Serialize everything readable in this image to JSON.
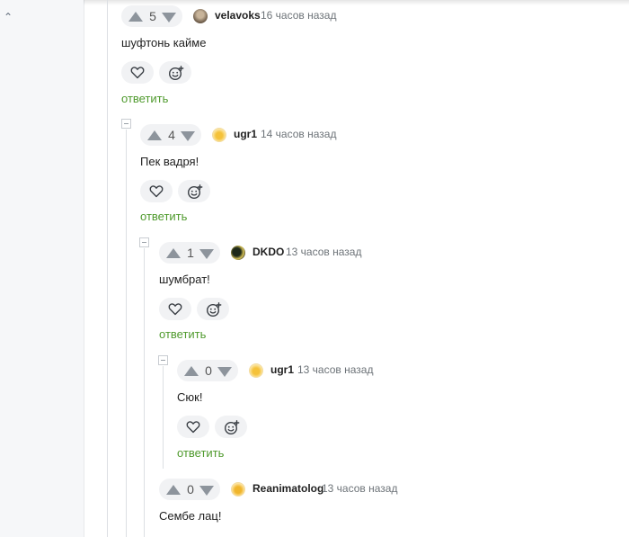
{
  "sidebar": {
    "collapse_icon": "chevron-up-icon",
    "collapse_glyph": "⌃"
  },
  "colors": {
    "reply_link": "#4f9a2d",
    "pill_bg": "#f1f2f4",
    "arrow": "#8d949c"
  },
  "comments": [
    {
      "rating": "5",
      "avatar_icon": "user-avatar",
      "username": "velavoks",
      "time": "16 часов назад",
      "text": "шуфтонь кайме",
      "reply": "ответить"
    },
    {
      "rating": "4",
      "avatar_icon": "user-avatar",
      "username": "ugr1",
      "time": "14 часов назад",
      "text": "Пек вадря!",
      "reply": "ответить"
    },
    {
      "rating": "1",
      "avatar_icon": "user-avatar",
      "username": "DKDO",
      "time": "13 часов назад",
      "text": "шумбрат!",
      "reply": "ответить"
    },
    {
      "rating": "0",
      "avatar_icon": "user-avatar",
      "username": "ugr1",
      "time": "13 часов назад",
      "text": "Сюк!",
      "reply": "ответить"
    },
    {
      "rating": "0",
      "avatar_icon": "user-avatar",
      "username": "Reanimatolog",
      "time": "13 часов назад",
      "text": "Сембе лац!"
    }
  ],
  "actions": {
    "like_icon": "heart-icon",
    "react_icon": "emoji-add-icon"
  }
}
